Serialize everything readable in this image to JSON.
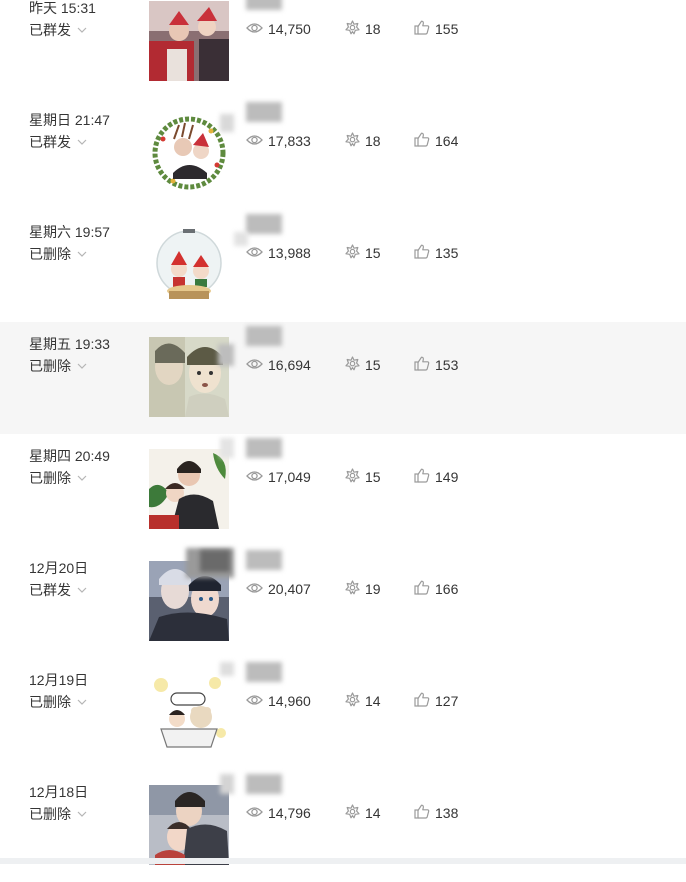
{
  "colors": {
    "text": "#353535",
    "icon": "#9a9a9a",
    "row_highlight": "#f6f6f6"
  },
  "icons": {
    "status_toggle": "chevron-down-icon",
    "reads": "eye-icon",
    "shares": "share-icon",
    "likes": "thumbs-up-icon"
  },
  "articles": [
    {
      "time": "昨天 15:31",
      "status": "已群发",
      "reads": "14,750",
      "shares": "18",
      "likes": "155",
      "thumb": "christmas-illustration"
    },
    {
      "time": "星期日 21:47",
      "status": "已群发",
      "reads": "17,833",
      "shares": "18",
      "likes": "164",
      "thumb": "christmas-wreath"
    },
    {
      "time": "星期六 19:57",
      "status": "已删除",
      "reads": "13,988",
      "shares": "15",
      "likes": "135",
      "thumb": "snow-globe"
    },
    {
      "time": "星期五 19:33",
      "status": "已删除",
      "reads": "16,694",
      "shares": "15",
      "likes": "153",
      "thumb": "comic-panel"
    },
    {
      "time": "星期四 20:49",
      "status": "已删除",
      "reads": "17,049",
      "shares": "15",
      "likes": "149",
      "thumb": "comic-cover"
    },
    {
      "time": "12月20日",
      "status": "已群发",
      "reads": "20,407",
      "shares": "19",
      "likes": "166",
      "thumb": "comic-embrace"
    },
    {
      "time": "12月19日",
      "status": "已删除",
      "reads": "14,960",
      "shares": "14",
      "likes": "127",
      "thumb": "cartoon-bath"
    },
    {
      "time": "12月18日",
      "status": "已删除",
      "reads": "14,796",
      "shares": "14",
      "likes": "138",
      "thumb": "comic-couple"
    }
  ]
}
